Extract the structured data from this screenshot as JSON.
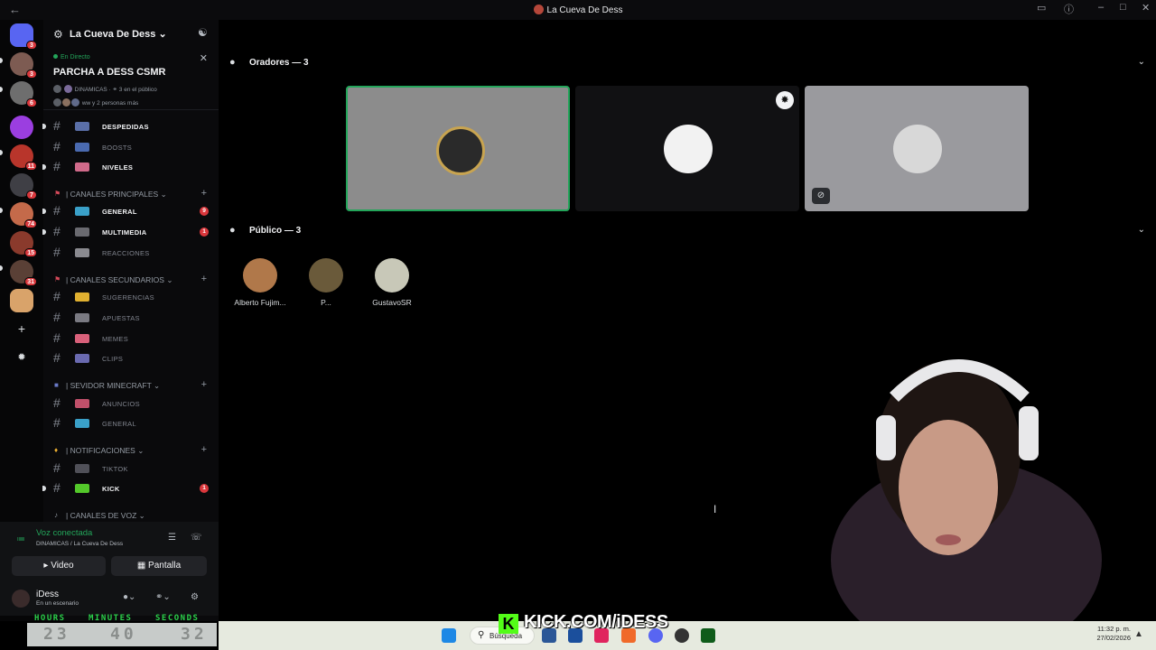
{
  "window": {
    "title": "La Cueva De Dess"
  },
  "server": {
    "name": "La Cueva De Dess"
  },
  "stage": {
    "live_label": "En Directo",
    "title": "PARCHA A DESS CSMR",
    "meta_channel": "DINAMICAS",
    "meta_audience": "3 en el público",
    "meta_people": "ww y 2 personas más"
  },
  "server_rail": {
    "badges": [
      "3",
      "3",
      "6",
      "11",
      "7",
      "74",
      "15",
      "31"
    ]
  },
  "channels_top": [
    {
      "label": "DESPEDIDAS",
      "bold": true
    },
    {
      "label": "BOOSTS",
      "bold": false
    },
    {
      "label": "NIVELES",
      "bold": true
    }
  ],
  "categories": [
    {
      "label": "| CANALES PRINCIPALES",
      "channels": [
        {
          "label": "GENERAL",
          "bold": true,
          "count": "9"
        },
        {
          "label": "MULTIMEDIA",
          "bold": true,
          "count": "1"
        },
        {
          "label": "REACCIONES",
          "bold": false,
          "count": ""
        }
      ]
    },
    {
      "label": "| CANALES SECUNDARIOS",
      "channels": [
        {
          "label": "SUGERENCIAS",
          "bold": false
        },
        {
          "label": "APUESTAS",
          "bold": false
        },
        {
          "label": "MEMES",
          "bold": false
        },
        {
          "label": "CLIPS",
          "bold": false
        }
      ]
    },
    {
      "label": "| SEVIDOR MINECRAFT",
      "channels": [
        {
          "label": "ANUNCIOS",
          "bold": false
        },
        {
          "label": "GENERAL",
          "bold": false
        }
      ]
    },
    {
      "label": "| NOTIFICACIONES",
      "channels": [
        {
          "label": "TIKTOK",
          "bold": false
        },
        {
          "label": "KICK",
          "bold": true,
          "count": "1"
        }
      ]
    },
    {
      "label": "| CANALES DE VOZ",
      "channels": []
    }
  ],
  "voice": {
    "status": "Voz conectada",
    "location": "DINAMICAS / La Cueva De Dess",
    "video_label": "Video",
    "screen_label": "Pantalla"
  },
  "user": {
    "name": "iDess",
    "status": "En un escenario"
  },
  "timer": {
    "hours_label": "HOURS",
    "minutes_label": "MINUTES",
    "seconds_label": "SECONDS",
    "hours": "23",
    "minutes": "40",
    "seconds": "32"
  },
  "main": {
    "speakers_header": "Oradores — 3",
    "audience_header": "Público — 3",
    "audience": [
      {
        "name": "Alberto Fujim..."
      },
      {
        "name": "P..."
      },
      {
        "name": "GustavoSR"
      }
    ]
  },
  "overlay": {
    "kick_text": "KICK.COM/iDESS",
    "kick_logo": "K"
  },
  "taskbar": {
    "search": "Búsqueda",
    "time": "11:32 p. m.",
    "date": "27/02/2026"
  },
  "colors": {
    "accent_green": "#23a55a",
    "badge_red": "#da373c",
    "kick_green": "#53fc18"
  }
}
